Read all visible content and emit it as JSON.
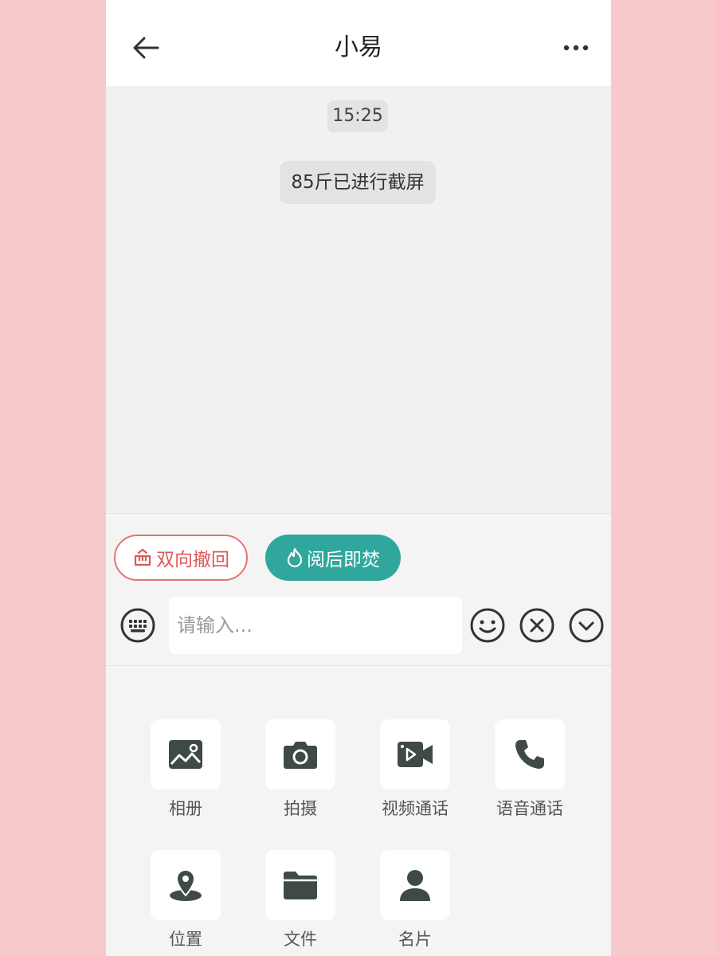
{
  "header": {
    "title": "小易"
  },
  "chat": {
    "timestamp": "15:25",
    "system_message": "85斤已进行截屏"
  },
  "chips": {
    "recall_label": "双向撤回",
    "burn_label": "阅后即焚"
  },
  "input": {
    "placeholder": "请输入...",
    "value": ""
  },
  "tools": [
    {
      "label": "相册",
      "icon": "image-icon"
    },
    {
      "label": "拍摄",
      "icon": "camera-icon"
    },
    {
      "label": "视频通话",
      "icon": "video-call-icon"
    },
    {
      "label": "语音通话",
      "icon": "phone-icon"
    },
    {
      "label": "位置",
      "icon": "location-icon"
    },
    {
      "label": "文件",
      "icon": "folder-icon"
    },
    {
      "label": "名片",
      "icon": "contact-card-icon"
    }
  ],
  "colors": {
    "background": "#f8c9cc",
    "accent_teal": "#30a79c",
    "accent_red": "#e05757",
    "icon_dark": "#3f4a48"
  }
}
